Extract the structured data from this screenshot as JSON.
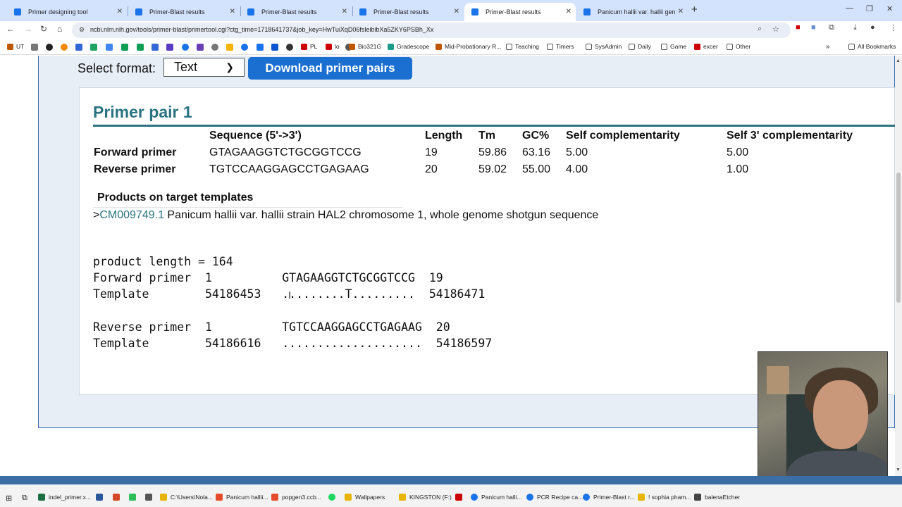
{
  "browser": {
    "tabs": [
      {
        "label": "Primer designing tool",
        "active": false
      },
      {
        "label": "Primer-Blast results",
        "active": false
      },
      {
        "label": "Primer-Blast results",
        "active": false
      },
      {
        "label": "Primer-Blast results",
        "active": false
      },
      {
        "label": "Primer-Blast results",
        "active": true
      },
      {
        "label": "Panicum hallii var. hallii genom",
        "active": false
      }
    ],
    "close_glyph": "✕",
    "new_tab_glyph": "+",
    "url": "ncbi.nlm.nih.gov/tools/primer-blast/primertool.cgi?ctg_time=1718641737&job_key=HwTuiXqD06fsleibibXa5ZKY6PSBh_Xx",
    "bookmarks": [
      {
        "label": "UT",
        "color": "#bf5700"
      },
      {
        "label": "PL",
        "color": "#cc0000"
      },
      {
        "label": "lo",
        "color": "#cc0000"
      },
      {
        "label": "Bio321G",
        "color": "#bf5700"
      },
      {
        "label": "Gradescope",
        "color": "#1a9b8e"
      },
      {
        "label": "Mid-Probationary R...",
        "color": "#bf5700"
      },
      {
        "label": "Teaching",
        "color": "#555555"
      },
      {
        "label": "Timers",
        "color": "#555555"
      },
      {
        "label": "SysAdmin",
        "color": "#555555"
      },
      {
        "label": "Daily",
        "color": "#555555"
      },
      {
        "label": "Game",
        "color": "#555555"
      },
      {
        "label": "excer",
        "color": "#cc0000"
      },
      {
        "label": "Other",
        "color": "#555555"
      },
      {
        "label": "All Bookmarks",
        "color": "#555555"
      }
    ]
  },
  "format": {
    "label": "Select format:",
    "selected": "Text",
    "download_label": "Download primer pairs"
  },
  "primer_pair": {
    "title": "Primer pair 1",
    "headers": [
      "Sequence (5'->3')",
      "Length",
      "Tm",
      "GC%",
      "Self complementarity",
      "Self 3' complementarity"
    ],
    "rows": [
      {
        "label": "Forward primer",
        "seq": "GTAGAAGGTCTGCGGTCCG",
        "length": "19",
        "tm": "59.86",
        "gc": "63.16",
        "self": "5.00",
        "self3": "5.00"
      },
      {
        "label": "Reverse primer",
        "seq": "TGTCCAAGGAGCCTGAGAAG",
        "length": "20",
        "tm": "59.02",
        "gc": "55.00",
        "self": "4.00",
        "self3": "1.00"
      }
    ]
  },
  "products": {
    "heading": "Products on target templates",
    "prefix": ">",
    "accession": "CM009749.1",
    "description": " Panicum hallii var. hallii strain HAL2 chromosome 1, whole genome shotgun sequence",
    "alignment_lines": [
      "product length = 164",
      "Forward primer  1          GTAGAAGGTCTGCGGTCCG  19",
      "Template        54186453   .........T.........  54186471",
      "",
      "Reverse primer  1          TGTCCAAGGAGCCTGAGAAG  20",
      "Template        54186616   ....................  54186597"
    ]
  },
  "taskbar": {
    "items": [
      {
        "label": "indel_primer.x...",
        "color": "#1d6f42"
      },
      {
        "label": "C:\\Users\\Nola...",
        "color": "#e8b400"
      },
      {
        "label": "Panicum hallii...",
        "color": "#e44c2c"
      },
      {
        "label": "popgen3.ccb...",
        "color": "#e44c2c"
      },
      {
        "label": "Wallpapers",
        "color": "#e8b400"
      },
      {
        "label": "KINGSTON (F:)",
        "color": "#e8b400"
      },
      {
        "label": "Panicum halli...",
        "color": "#1a73e8"
      },
      {
        "label": "PCR Recipe ca...",
        "color": "#1a73e8"
      },
      {
        "label": "Primer-Blast r...",
        "color": "#1a73e8"
      },
      {
        "label": "! sophia pham...",
        "color": "#e8b400"
      },
      {
        "label": "balenaEtcher",
        "color": "#444444"
      }
    ]
  },
  "icons": [
    "back-arrow-icon",
    "forward-arrow-icon",
    "reload-icon",
    "home-icon",
    "zoom-icon",
    "star-icon",
    "extensions-icon",
    "download-icon",
    "profile-icon",
    "menu-icon",
    "chevron-down-icon",
    "text-cursor-icon"
  ]
}
